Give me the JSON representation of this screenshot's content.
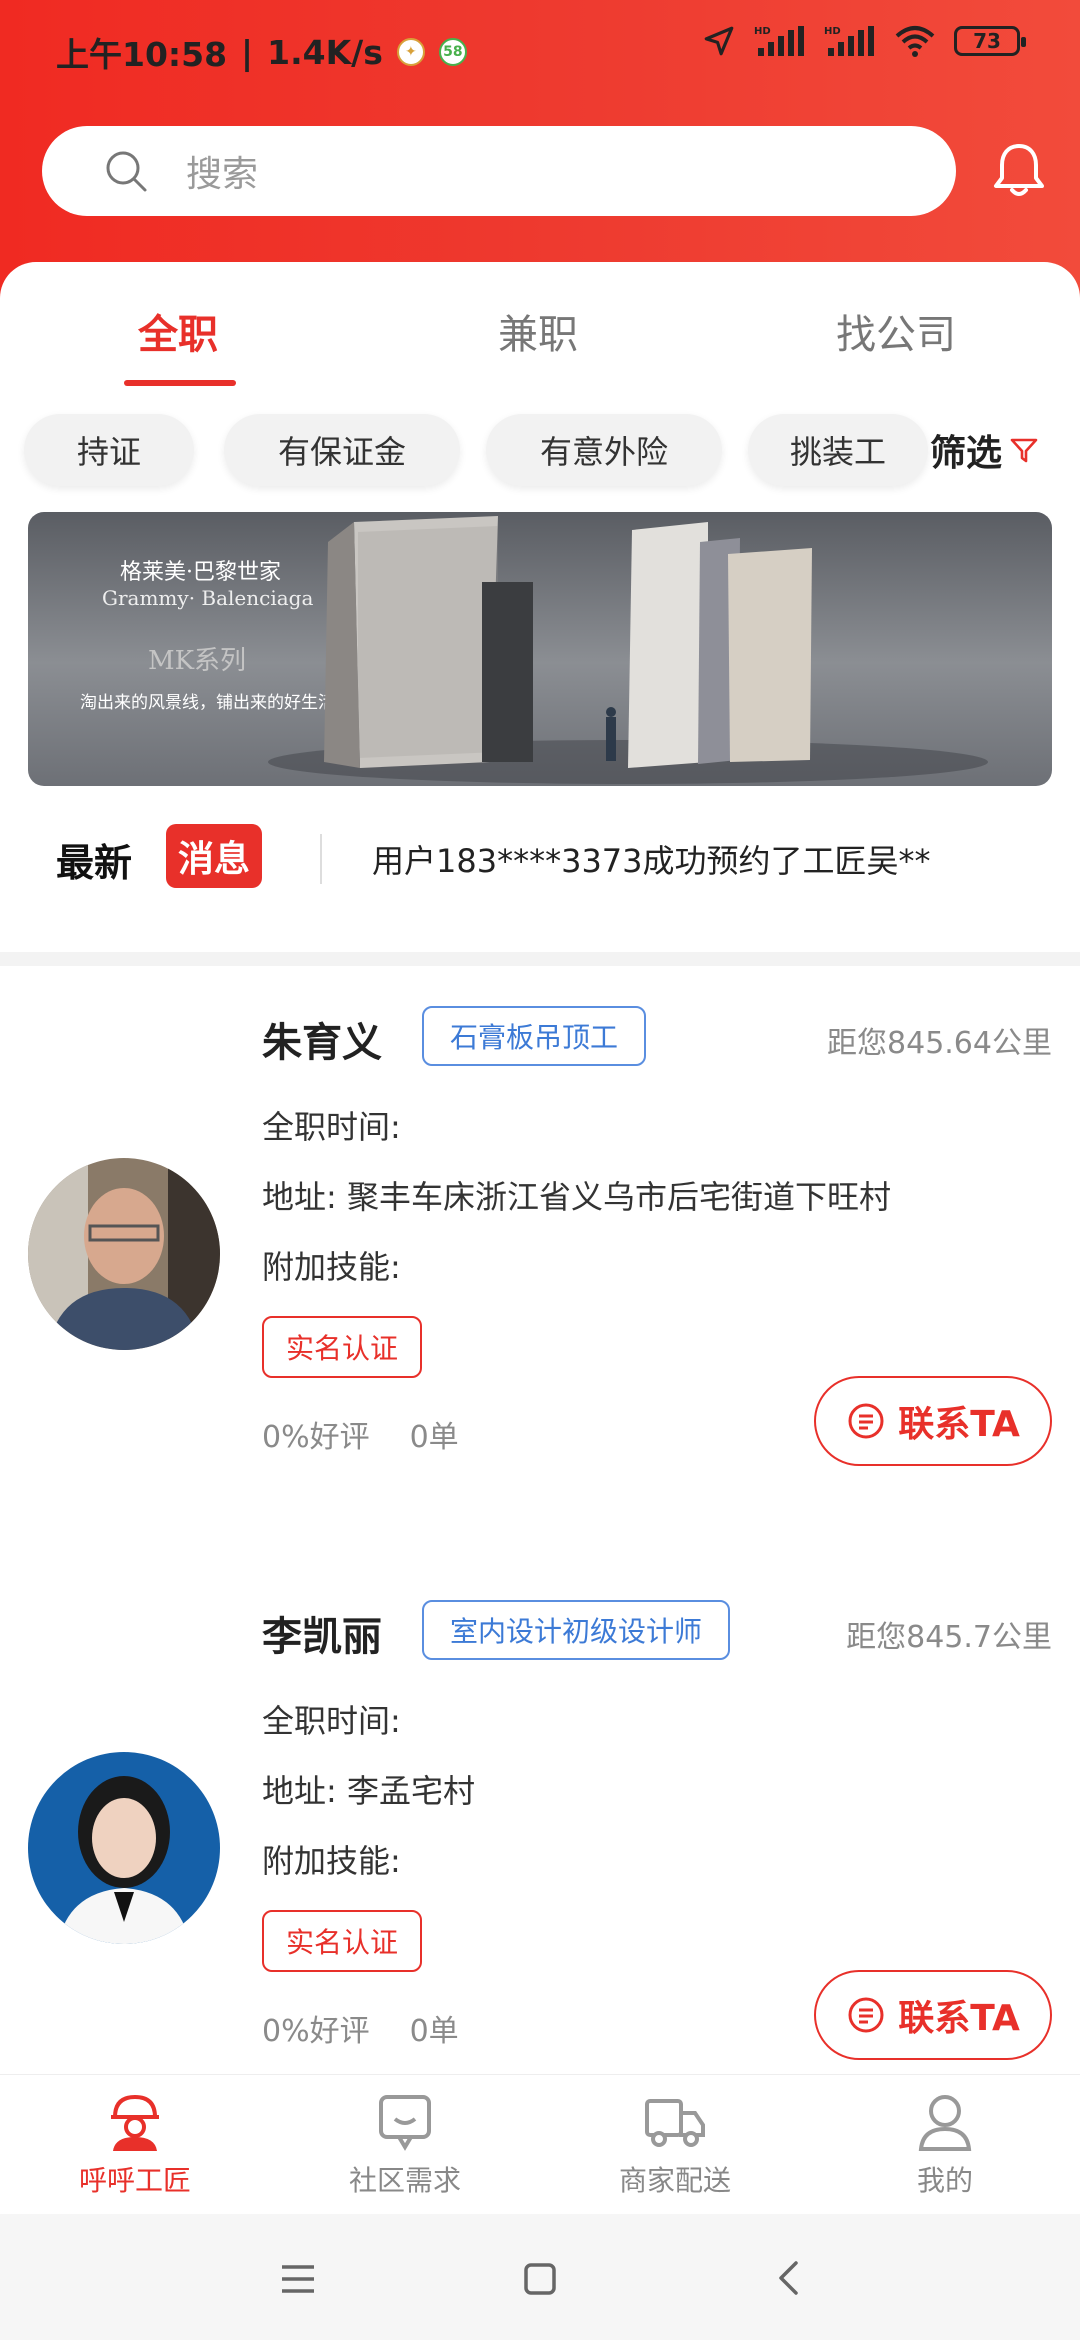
{
  "status_bar": {
    "time": "上午10:58",
    "speed": "1.4K/s",
    "separator": "|",
    "icon_a": "sina-icon",
    "icon_b_label": "58",
    "battery": "73",
    "icons": [
      "location-arrow-icon",
      "hd-signal-icon",
      "hd-signal-icon",
      "wifi-icon"
    ]
  },
  "search": {
    "placeholder": "搜索"
  },
  "tabs": [
    {
      "label": "全职",
      "active": true
    },
    {
      "label": "兼职",
      "active": false
    },
    {
      "label": "找公司",
      "active": false
    }
  ],
  "chips": [
    "持证",
    "有保证金",
    "有意外险",
    "挑装工"
  ],
  "filter_label": "筛选",
  "banner": {
    "title": "格莱美·巴黎世家",
    "subtitle": "Grammy· Balenciaga",
    "series": "MK系列",
    "slogan": "淘出来的风景线，铺出来的好生活"
  },
  "news": {
    "latest": "最新",
    "badge": "消息",
    "text": "用户183****3373成功预约了工匠吴**"
  },
  "workers": [
    {
      "name": "朱育义",
      "tag": "石膏板吊顶工",
      "distance": "距您845.64公里",
      "time_label": "全职时间:",
      "address": "地址: 聚丰车床浙江省义乌市后宅街道下旺村",
      "skills_label": "附加技能:",
      "verify": "实名认证",
      "rating": "0%好评",
      "orders": "0单",
      "contact": "联系TA"
    },
    {
      "name": "李凯丽",
      "tag": "室内设计初级设计师",
      "distance": "距您845.7公里",
      "time_label": "全职时间:",
      "address": "地址: 李孟宅村",
      "skills_label": "附加技能:",
      "verify": "实名认证",
      "rating": "0%好评",
      "orders": "0单",
      "contact": "联系TA"
    }
  ],
  "tabbar": [
    {
      "label": "呼呼工匠",
      "icon": "worker-helmet-icon",
      "active": true
    },
    {
      "label": "社区需求",
      "icon": "chat-bubble-icon",
      "active": false
    },
    {
      "label": "商家配送",
      "icon": "truck-icon",
      "active": false
    },
    {
      "label": "我的",
      "icon": "person-icon",
      "active": false
    }
  ],
  "colors": {
    "brand": "#e8302a",
    "tag_blue": "#3c7ad6"
  }
}
